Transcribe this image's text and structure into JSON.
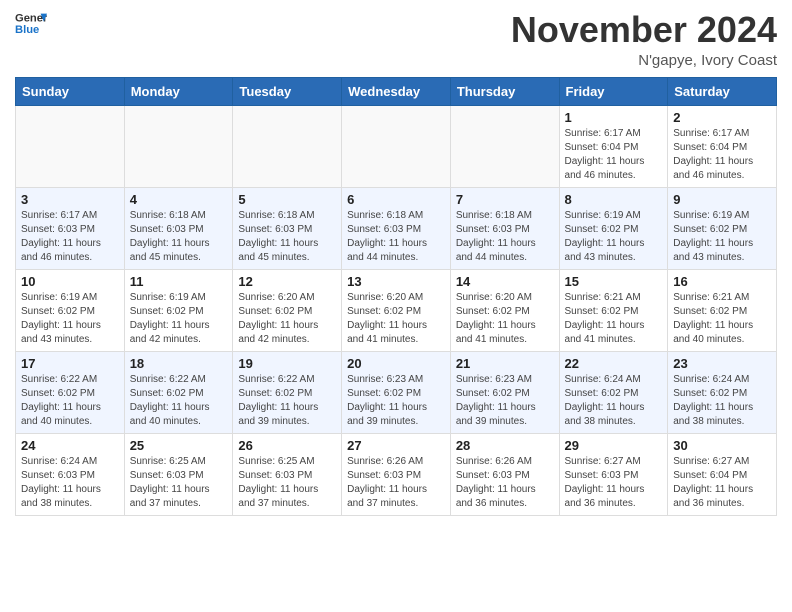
{
  "header": {
    "logo_line1": "General",
    "logo_line2": "Blue",
    "month_title": "November 2024",
    "location": "N'gapye, Ivory Coast"
  },
  "days_of_week": [
    "Sunday",
    "Monday",
    "Tuesday",
    "Wednesday",
    "Thursday",
    "Friday",
    "Saturday"
  ],
  "weeks": [
    [
      {
        "day": "",
        "info": ""
      },
      {
        "day": "",
        "info": ""
      },
      {
        "day": "",
        "info": ""
      },
      {
        "day": "",
        "info": ""
      },
      {
        "day": "",
        "info": ""
      },
      {
        "day": "1",
        "info": "Sunrise: 6:17 AM\nSunset: 6:04 PM\nDaylight: 11 hours and 46 minutes."
      },
      {
        "day": "2",
        "info": "Sunrise: 6:17 AM\nSunset: 6:04 PM\nDaylight: 11 hours and 46 minutes."
      }
    ],
    [
      {
        "day": "3",
        "info": "Sunrise: 6:17 AM\nSunset: 6:03 PM\nDaylight: 11 hours and 46 minutes."
      },
      {
        "day": "4",
        "info": "Sunrise: 6:18 AM\nSunset: 6:03 PM\nDaylight: 11 hours and 45 minutes."
      },
      {
        "day": "5",
        "info": "Sunrise: 6:18 AM\nSunset: 6:03 PM\nDaylight: 11 hours and 45 minutes."
      },
      {
        "day": "6",
        "info": "Sunrise: 6:18 AM\nSunset: 6:03 PM\nDaylight: 11 hours and 44 minutes."
      },
      {
        "day": "7",
        "info": "Sunrise: 6:18 AM\nSunset: 6:03 PM\nDaylight: 11 hours and 44 minutes."
      },
      {
        "day": "8",
        "info": "Sunrise: 6:19 AM\nSunset: 6:02 PM\nDaylight: 11 hours and 43 minutes."
      },
      {
        "day": "9",
        "info": "Sunrise: 6:19 AM\nSunset: 6:02 PM\nDaylight: 11 hours and 43 minutes."
      }
    ],
    [
      {
        "day": "10",
        "info": "Sunrise: 6:19 AM\nSunset: 6:02 PM\nDaylight: 11 hours and 43 minutes."
      },
      {
        "day": "11",
        "info": "Sunrise: 6:19 AM\nSunset: 6:02 PM\nDaylight: 11 hours and 42 minutes."
      },
      {
        "day": "12",
        "info": "Sunrise: 6:20 AM\nSunset: 6:02 PM\nDaylight: 11 hours and 42 minutes."
      },
      {
        "day": "13",
        "info": "Sunrise: 6:20 AM\nSunset: 6:02 PM\nDaylight: 11 hours and 41 minutes."
      },
      {
        "day": "14",
        "info": "Sunrise: 6:20 AM\nSunset: 6:02 PM\nDaylight: 11 hours and 41 minutes."
      },
      {
        "day": "15",
        "info": "Sunrise: 6:21 AM\nSunset: 6:02 PM\nDaylight: 11 hours and 41 minutes."
      },
      {
        "day": "16",
        "info": "Sunrise: 6:21 AM\nSunset: 6:02 PM\nDaylight: 11 hours and 40 minutes."
      }
    ],
    [
      {
        "day": "17",
        "info": "Sunrise: 6:22 AM\nSunset: 6:02 PM\nDaylight: 11 hours and 40 minutes."
      },
      {
        "day": "18",
        "info": "Sunrise: 6:22 AM\nSunset: 6:02 PM\nDaylight: 11 hours and 40 minutes."
      },
      {
        "day": "19",
        "info": "Sunrise: 6:22 AM\nSunset: 6:02 PM\nDaylight: 11 hours and 39 minutes."
      },
      {
        "day": "20",
        "info": "Sunrise: 6:23 AM\nSunset: 6:02 PM\nDaylight: 11 hours and 39 minutes."
      },
      {
        "day": "21",
        "info": "Sunrise: 6:23 AM\nSunset: 6:02 PM\nDaylight: 11 hours and 39 minutes."
      },
      {
        "day": "22",
        "info": "Sunrise: 6:24 AM\nSunset: 6:02 PM\nDaylight: 11 hours and 38 minutes."
      },
      {
        "day": "23",
        "info": "Sunrise: 6:24 AM\nSunset: 6:02 PM\nDaylight: 11 hours and 38 minutes."
      }
    ],
    [
      {
        "day": "24",
        "info": "Sunrise: 6:24 AM\nSunset: 6:03 PM\nDaylight: 11 hours and 38 minutes."
      },
      {
        "day": "25",
        "info": "Sunrise: 6:25 AM\nSunset: 6:03 PM\nDaylight: 11 hours and 37 minutes."
      },
      {
        "day": "26",
        "info": "Sunrise: 6:25 AM\nSunset: 6:03 PM\nDaylight: 11 hours and 37 minutes."
      },
      {
        "day": "27",
        "info": "Sunrise: 6:26 AM\nSunset: 6:03 PM\nDaylight: 11 hours and 37 minutes."
      },
      {
        "day": "28",
        "info": "Sunrise: 6:26 AM\nSunset: 6:03 PM\nDaylight: 11 hours and 36 minutes."
      },
      {
        "day": "29",
        "info": "Sunrise: 6:27 AM\nSunset: 6:03 PM\nDaylight: 11 hours and 36 minutes."
      },
      {
        "day": "30",
        "info": "Sunrise: 6:27 AM\nSunset: 6:04 PM\nDaylight: 11 hours and 36 minutes."
      }
    ]
  ]
}
